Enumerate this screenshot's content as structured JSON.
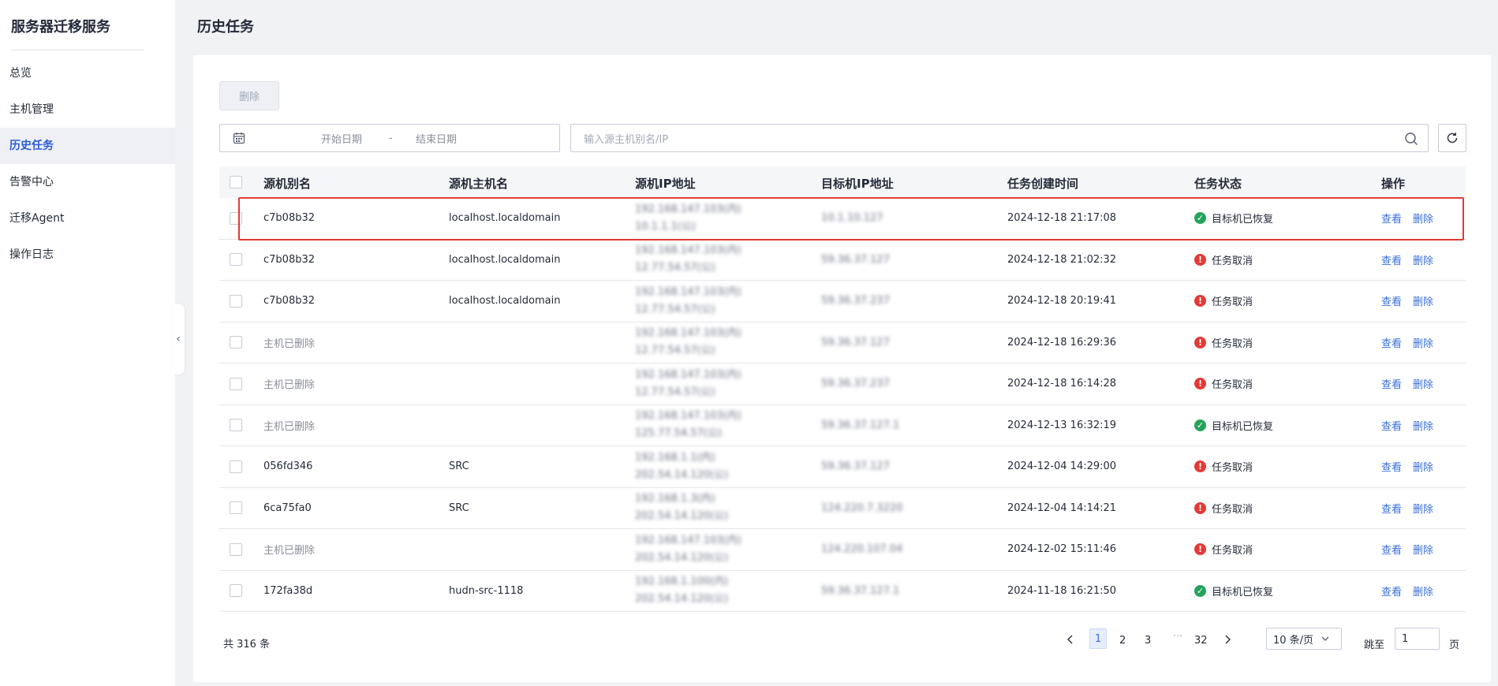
{
  "sidebar": {
    "title": "服务器迁移服务",
    "items": [
      {
        "label": "总览"
      },
      {
        "label": "主机管理"
      },
      {
        "label": "历史任务",
        "active": true
      },
      {
        "label": "告警中心"
      },
      {
        "label": "迁移Agent"
      },
      {
        "label": "操作日志"
      }
    ]
  },
  "page": {
    "title": "历史任务"
  },
  "toolbar": {
    "delete_label": "删除",
    "date_start_placeholder": "开始日期",
    "date_separator": "-",
    "date_end_placeholder": "结束日期",
    "search_placeholder": "输入源主机别名/IP"
  },
  "table": {
    "headers": [
      "源机别名",
      "源机主机名",
      "源机IP地址",
      "目标机IP地址",
      "任务创建时间",
      "任务状态",
      "操作"
    ],
    "rows": [
      {
        "alias": "c7b08b32",
        "host": "localhost.localdomain",
        "src_ip_1": "192.168.147.103(内)",
        "src_ip_2": "10.1.1.1(公)",
        "dst_ip": "10.1.10.127",
        "time": "2024-12-18 21:17:08",
        "status": "目标机已恢复",
        "status_type": "ok"
      },
      {
        "alias": "c7b08b32",
        "host": "localhost.localdomain",
        "src_ip_1": "192.168.147.103(内)",
        "src_ip_2": "12.77.54.57(公)",
        "dst_ip": "59.36.37.127",
        "time": "2024-12-18 21:02:32",
        "status": "任务取消",
        "status_type": "err"
      },
      {
        "alias": "c7b08b32",
        "host": "localhost.localdomain",
        "src_ip_1": "192.168.147.103(内)",
        "src_ip_2": "12.77.54.57(公)",
        "dst_ip": "59.36.37.237",
        "time": "2024-12-18 20:19:41",
        "status": "任务取消",
        "status_type": "err"
      },
      {
        "alias": "主机已删除",
        "host": "",
        "src_ip_1": "192.168.147.103(内)",
        "src_ip_2": "12.77.54.57(公)",
        "dst_ip": "59.36.37.127",
        "time": "2024-12-18 16:29:36",
        "status": "任务取消",
        "status_type": "err"
      },
      {
        "alias": "主机已删除",
        "host": "",
        "src_ip_1": "192.168.147.103(内)",
        "src_ip_2": "12.77.54.57(公)",
        "dst_ip": "59.36.37.237",
        "time": "2024-12-18 16:14:28",
        "status": "任务取消",
        "status_type": "err"
      },
      {
        "alias": "主机已删除",
        "host": "",
        "src_ip_1": "192.168.147.103(内)",
        "src_ip_2": "125.77.54.57(公)",
        "dst_ip": "59.36.37.127.1",
        "time": "2024-12-13 16:32:19",
        "status": "目标机已恢复",
        "status_type": "ok"
      },
      {
        "alias": "056fd346",
        "host": "SRC",
        "src_ip_1": "192.168.1.1(内)",
        "src_ip_2": "202.54.14.120(公)",
        "dst_ip": "59.36.37.127",
        "time": "2024-12-04 14:29:00",
        "status": "任务取消",
        "status_type": "err"
      },
      {
        "alias": "6ca75fa0",
        "host": "SRC",
        "src_ip_1": "192.168.1.3(内)",
        "src_ip_2": "202.54.14.120(公)",
        "dst_ip": "124.220.7.3220",
        "time": "2024-12-04 14:14:21",
        "status": "任务取消",
        "status_type": "err"
      },
      {
        "alias": "主机已删除",
        "host": "",
        "src_ip_1": "192.168.147.103(内)",
        "src_ip_2": "202.54.14.120(公)",
        "dst_ip": "124.220.107.04",
        "time": "2024-12-02 15:11:46",
        "status": "任务取消",
        "status_type": "err"
      },
      {
        "alias": "172fa38d",
        "host": "hudn-src-1118",
        "src_ip_1": "192.168.1.100(内)",
        "src_ip_2": "202.54.14.120(公)",
        "dst_ip": "59.36.37.127.1",
        "time": "2024-11-18 16:21:50",
        "status": "目标机已恢复",
        "status_type": "ok"
      }
    ],
    "ops": {
      "view": "查看",
      "delete": "删除"
    }
  },
  "pagination": {
    "total": "共 316 条",
    "pages": [
      "1",
      "2",
      "3",
      "···",
      "32"
    ],
    "current": "1",
    "page_size": "10 条/页",
    "jump_label": "跳至",
    "jump_value": "1",
    "page_label": "页"
  },
  "colors": {
    "accent": "#3a6fdb",
    "ok": "#24a35a",
    "error": "#e53935",
    "highlight": "#e53935"
  },
  "icons": {
    "calendar": "calendar-icon",
    "search": "search-icon",
    "refresh": "refresh-icon",
    "collapse": "chevron-left-icon"
  }
}
